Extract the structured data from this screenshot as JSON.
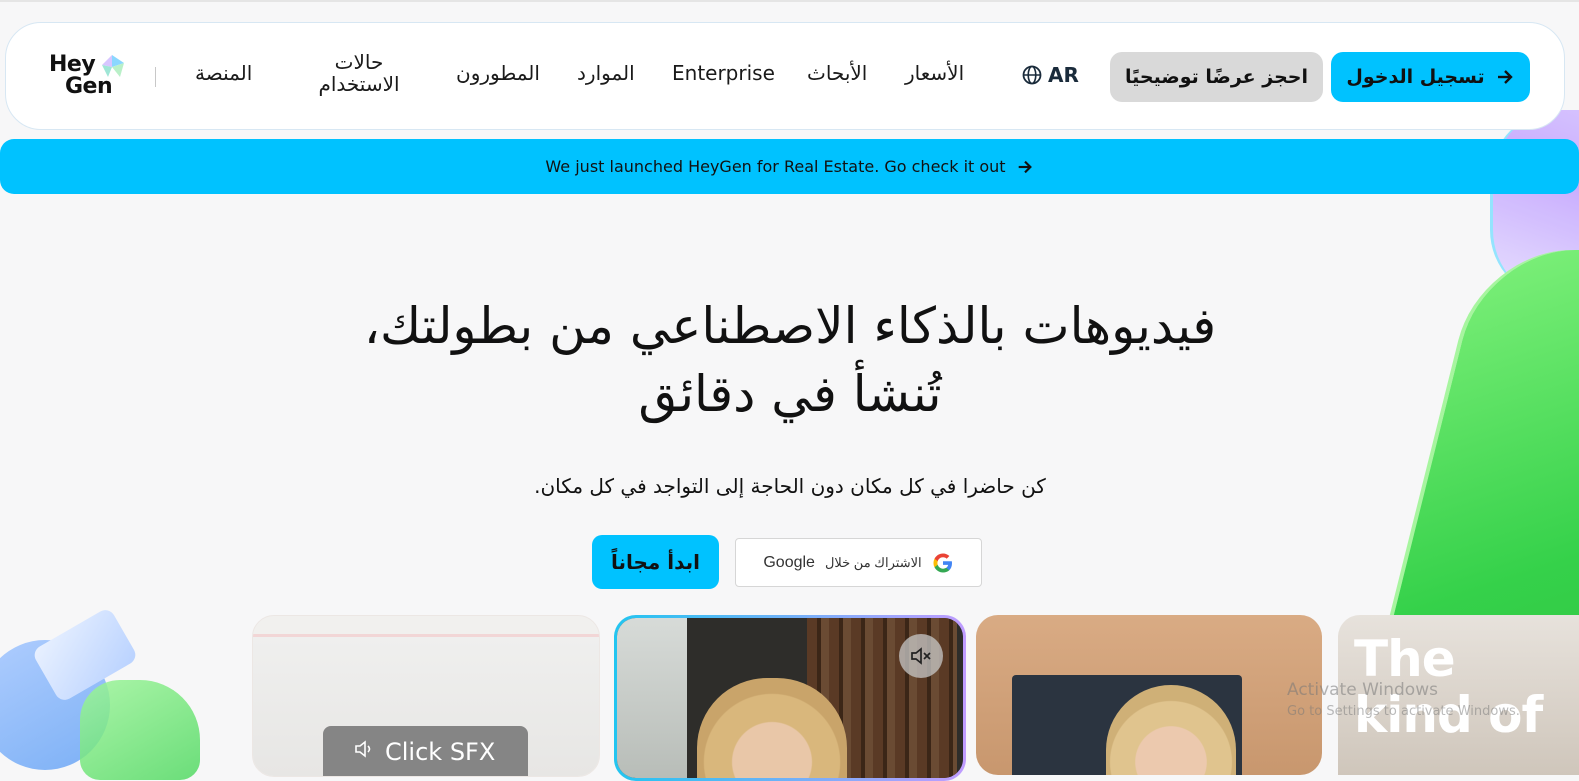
{
  "header": {
    "logo_top": "Hey",
    "logo_bottom": "Gen",
    "nav": {
      "platform": "المنصة",
      "use_cases_line1": "حالات",
      "use_cases_line2": "الاستخدام",
      "developers": "المطورون",
      "resources": "الموارد",
      "enterprise": "Enterprise",
      "research": "الأبحاث",
      "pricing": "الأسعار"
    },
    "language": "AR",
    "demo_button": "احجز عرضًا توضيحيًا",
    "login_button": "تسجيل الدخول"
  },
  "banner": {
    "text": "We just launched HeyGen for Real Estate. Go check it out"
  },
  "hero": {
    "title_line1": "فيديوهات بالذكاء الاصطناعي من بطولتك،",
    "title_line2": "تُنشأ في دقائق",
    "subtitle": "كن حاضرا في كل مكان دون الحاجة إلى التواجد في كل مكان.",
    "start_button": "ابدأ مجاناً",
    "google_button_ar": "الاشتراك من خلال",
    "google_button_brand": "Google"
  },
  "cards": {
    "card1_button": "Click SFX",
    "card4_text_line1": "The",
    "card4_text_line2": "kind of"
  },
  "watermark": {
    "line1": "Activate Windows",
    "line2": "Go to Settings to activate Windows."
  },
  "colors": {
    "accent": "#00c2ff",
    "demo_bg": "#d9d9d9",
    "background": "#f7f7f8"
  }
}
